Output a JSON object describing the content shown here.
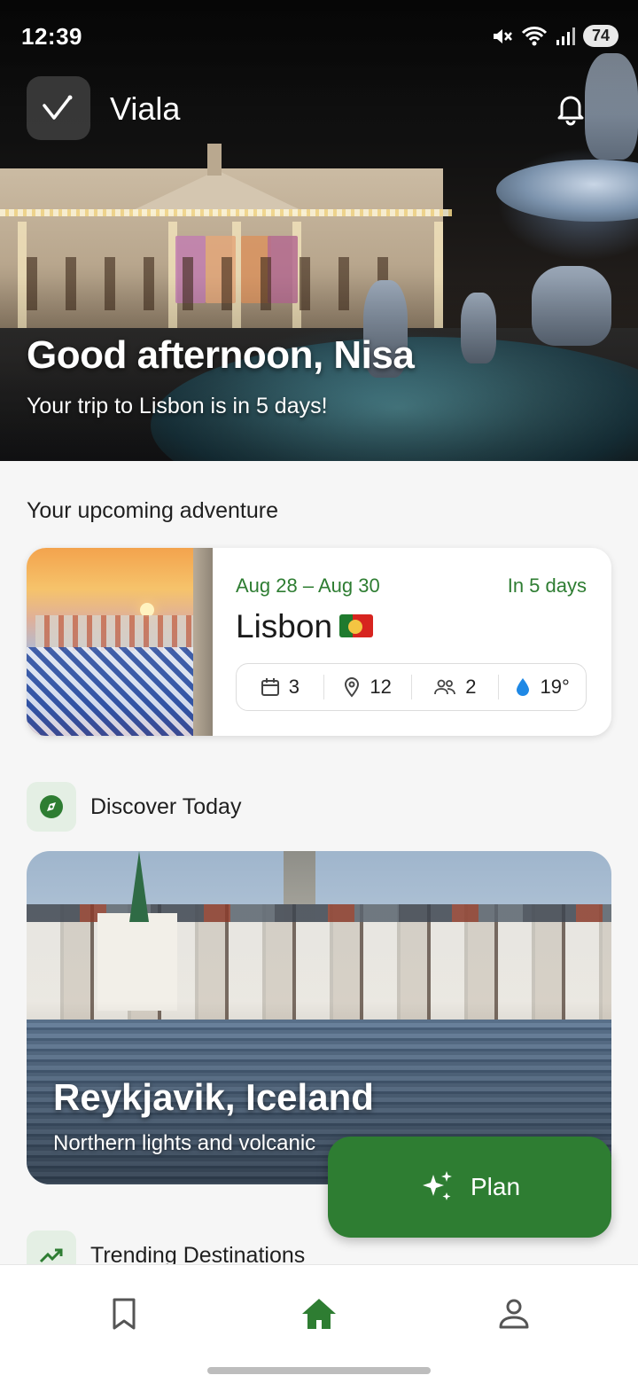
{
  "status_bar": {
    "time": "12:39",
    "battery": "74"
  },
  "app": {
    "name": "Viala"
  },
  "hero": {
    "greeting": "Good afternoon, Nisa",
    "subtitle": "Your trip to Lisbon is in 5 days!"
  },
  "upcoming": {
    "section_title": "Your upcoming adventure",
    "dates": "Aug 28 – Aug 30",
    "countdown": "In 5 days",
    "city": "Lisbon",
    "stats": {
      "days": "3",
      "places": "12",
      "travelers": "2",
      "weather": "19°"
    }
  },
  "discover": {
    "section_title": "Discover Today",
    "title": "Reykjavik, Iceland",
    "subtitle": "Northern lights and volcanic"
  },
  "trending": {
    "section_title": "Trending Destinations"
  },
  "fab": {
    "label": "Plan"
  },
  "colors": {
    "accent": "#2e7d32",
    "accent_light": "#e4efe4",
    "weather_drop": "#1e88e5"
  },
  "icons": [
    "mute-icon",
    "wifi-icon",
    "signal-icon",
    "bell-icon",
    "calendar-icon",
    "location-pin-icon",
    "people-icon",
    "water-drop-icon",
    "compass-icon",
    "sparkles-icon",
    "trending-up-icon",
    "bookmark-icon",
    "home-icon",
    "person-icon"
  ]
}
